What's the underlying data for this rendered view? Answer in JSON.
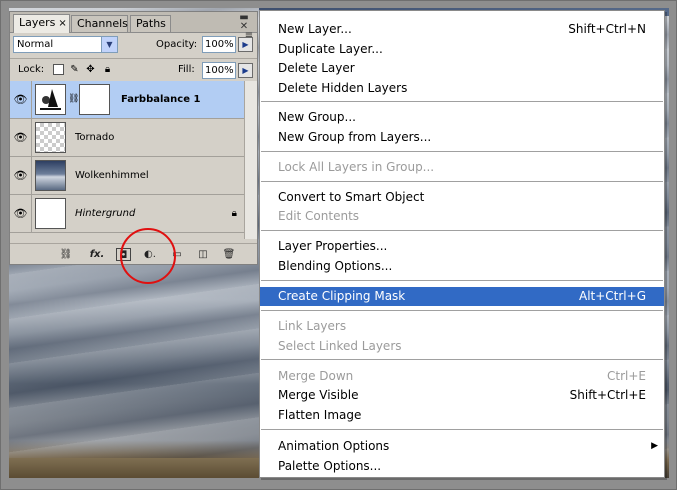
{
  "panel": {
    "tabs": [
      {
        "label": "Layers",
        "close": "×"
      },
      {
        "label": "Channels"
      },
      {
        "label": "Paths"
      }
    ],
    "blend_mode": "Normal",
    "opacity_label": "Opacity:",
    "opacity_value": "100%",
    "lock_label": "Lock:",
    "fill_label": "Fill:",
    "fill_value": "100%",
    "layers": [
      {
        "name": "Farbbalance 1",
        "selected": true
      },
      {
        "name": "Tornado"
      },
      {
        "name": "Wolkenhimmel"
      },
      {
        "name": "Hintergrund",
        "locked": true
      }
    ]
  },
  "menu": {
    "items": [
      {
        "label": "New Layer...",
        "shortcut": "Shift+Ctrl+N"
      },
      {
        "label": "Duplicate Layer..."
      },
      {
        "label": "Delete Layer"
      },
      {
        "label": "Delete Hidden Layers"
      },
      {
        "label": "New Group..."
      },
      {
        "label": "New Group from Layers..."
      },
      {
        "label": "Lock All Layers in Group...",
        "disabled": true
      },
      {
        "label": "Convert to Smart Object"
      },
      {
        "label": "Edit Contents",
        "disabled": true
      },
      {
        "label": "Layer Properties..."
      },
      {
        "label": "Blending Options..."
      },
      {
        "label": "Create Clipping Mask",
        "shortcut": "Alt+Ctrl+G",
        "highlighted": true
      },
      {
        "label": "Link Layers",
        "disabled": true
      },
      {
        "label": "Select Linked Layers",
        "disabled": true
      },
      {
        "label": "Merge Down",
        "shortcut": "Ctrl+E",
        "disabled": true
      },
      {
        "label": "Merge Visible",
        "shortcut": "Shift+Ctrl+E"
      },
      {
        "label": "Flatten Image"
      },
      {
        "label": "Animation Options"
      },
      {
        "label": "Palette Options..."
      }
    ]
  },
  "colors": {
    "menu_highlight": "#316ac5",
    "selected_layer": "#b2cdf3",
    "annotation_circle": "#e01010"
  }
}
